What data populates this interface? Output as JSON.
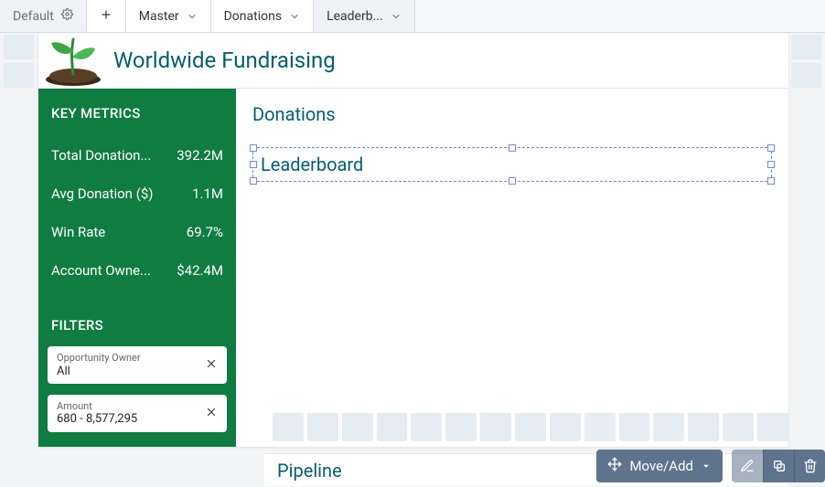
{
  "tabs": {
    "default_label": "Default",
    "items": [
      "Master",
      "Donations",
      "Leaderb..."
    ],
    "selected_index": 2
  },
  "page": {
    "title": "Worldwide Fundraising"
  },
  "sidebar": {
    "metrics_head": "KEY METRICS",
    "metrics": [
      {
        "label": "Total Donation...",
        "value": "392.2M"
      },
      {
        "label": "Avg Donation ($)",
        "value": "1.1M"
      },
      {
        "label": "Win Rate",
        "value": "69.7%"
      },
      {
        "label": "Account Owne...",
        "value": "$42.4M"
      }
    ],
    "filters_head": "FILTERS",
    "filters": [
      {
        "name": "Opportunity Owner",
        "value": "All"
      },
      {
        "name": "Amount",
        "value": "680 - 8,577,295"
      }
    ]
  },
  "main": {
    "sections": {
      "donations_title": "Donations",
      "leaderboard_title": "Leaderboard",
      "pipeline_title": "Pipeline"
    }
  },
  "toolbar": {
    "move_add_label": "Move/Add"
  },
  "colors": {
    "accent_teal": "#055e6e",
    "sidebar_green": "#107c41",
    "toolbar_slate": "#5f748c",
    "selection": "#7a87d4"
  }
}
